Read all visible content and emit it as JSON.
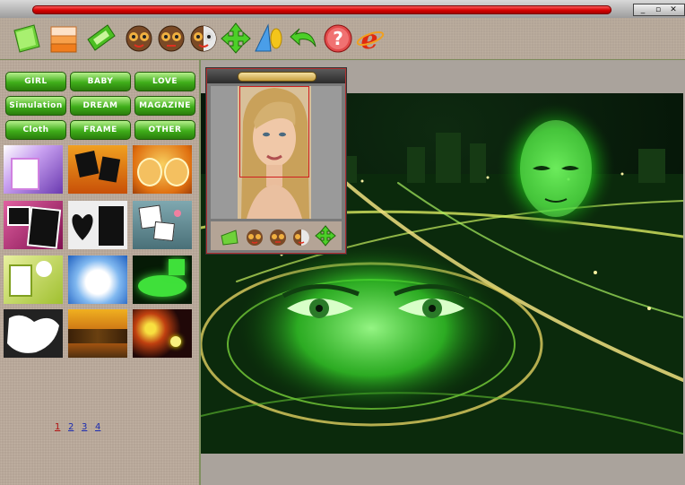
{
  "window": {
    "controls": {
      "minimize": "_",
      "maximize": "▫",
      "close": "✕"
    }
  },
  "toolbar": {
    "items": [
      {
        "name": "open",
        "icon": "green-folder-icon"
      },
      {
        "name": "save",
        "icon": "orange-stack-icon"
      },
      {
        "name": "edit",
        "icon": "green-card-icon"
      },
      {
        "name": "face1",
        "icon": "owl-face-icon"
      },
      {
        "name": "face2",
        "icon": "owl-face-icon"
      },
      {
        "name": "face3",
        "icon": "owl-face-icon"
      },
      {
        "name": "move",
        "icon": "move-arrows-icon"
      },
      {
        "name": "shape",
        "icon": "shape-tool-icon"
      },
      {
        "name": "undo",
        "icon": "undo-arrow-icon"
      },
      {
        "name": "help",
        "icon": "help-icon",
        "label": "?"
      },
      {
        "name": "web",
        "icon": "internet-explorer-icon",
        "label": "e"
      }
    ]
  },
  "categories": [
    "GIRL",
    "BABY",
    "LOVE",
    "Simulation",
    "DREAM",
    "MAGAZINE",
    "Cloth",
    "FRAME",
    "OTHER"
  ],
  "pagination": {
    "pages": [
      "1",
      "2",
      "3",
      "4"
    ],
    "current": "1"
  },
  "colors": {
    "accent_green": "#3fae1a",
    "title_red": "#d40000",
    "panel_bg": "#b4a496"
  }
}
